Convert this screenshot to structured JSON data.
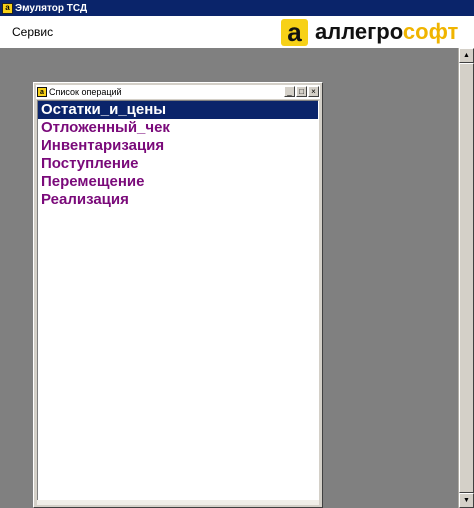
{
  "window": {
    "title": "Эмулятор ТСД",
    "icon_glyph": "а"
  },
  "menu": {
    "items": [
      {
        "label": "Сервис"
      }
    ]
  },
  "logo": {
    "mark": "а",
    "word_dark": "аллегро",
    "word_accent": "софт",
    "accent_color": "#f0b400"
  },
  "child_window": {
    "title": "Список операций",
    "icon_glyph": "а",
    "controls": {
      "minimize": "_",
      "maximize": "□",
      "close": "×"
    },
    "items": [
      {
        "label": "Остатки_и_цены",
        "selected": true
      },
      {
        "label": "Отложенный_чек",
        "selected": false
      },
      {
        "label": "Инвентаризация",
        "selected": false
      },
      {
        "label": "Поступление",
        "selected": false
      },
      {
        "label": "Перемещение",
        "selected": false
      },
      {
        "label": "Реализация",
        "selected": false
      }
    ]
  },
  "scrollbar": {
    "up": "▲",
    "down": "▼"
  }
}
